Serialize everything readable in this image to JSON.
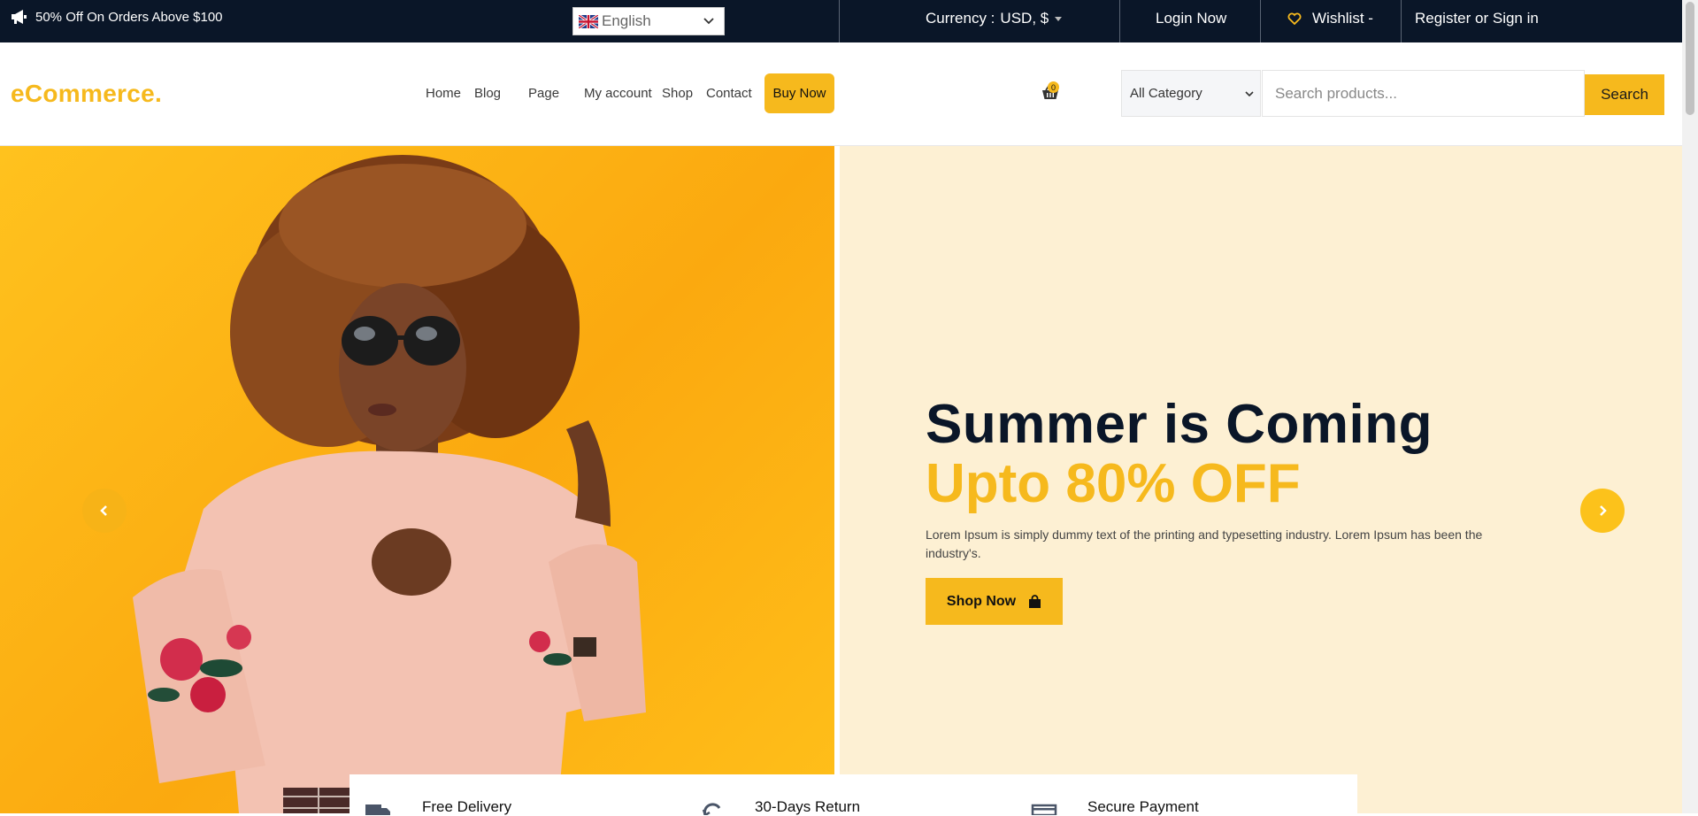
{
  "topbar": {
    "promo_text": "50% Off On Orders Above $100",
    "language": "English",
    "currency_label": "Currency :",
    "currency_value": "USD, $",
    "login": "Login Now",
    "wishlist": "Wishlist -",
    "register": "Register or Sign in"
  },
  "header": {
    "logo": "eCommerce.",
    "nav": [
      "Home",
      "Blog",
      "Page",
      "My account",
      "Shop",
      "Contact"
    ],
    "buy_now": "Buy Now",
    "cart_count": "0",
    "category_selected": "All Category",
    "search_placeholder": "Search products...",
    "search_button": "Search"
  },
  "hero": {
    "title": "Summer is Coming",
    "subtitle": "Upto 80% OFF",
    "description": "Lorem Ipsum is simply dummy text of the printing and typesetting industry. Lorem Ipsum has been the industry's.",
    "cta": "Shop Now"
  },
  "features": [
    "Free Delivery",
    "30-Days Return",
    "Secure Payment"
  ],
  "colors": {
    "accent": "#f6b91d",
    "navy": "#0a1628",
    "hero_bg": "#fdf0d3"
  },
  "icons": [
    "megaphone-icon",
    "uk-flag-icon",
    "chevron-down-icon",
    "heart-icon",
    "shopping-basket-icon",
    "shopping-bag-icon",
    "arrow-left-icon",
    "arrow-right-icon",
    "truck-icon",
    "return-icon",
    "card-icon"
  ]
}
